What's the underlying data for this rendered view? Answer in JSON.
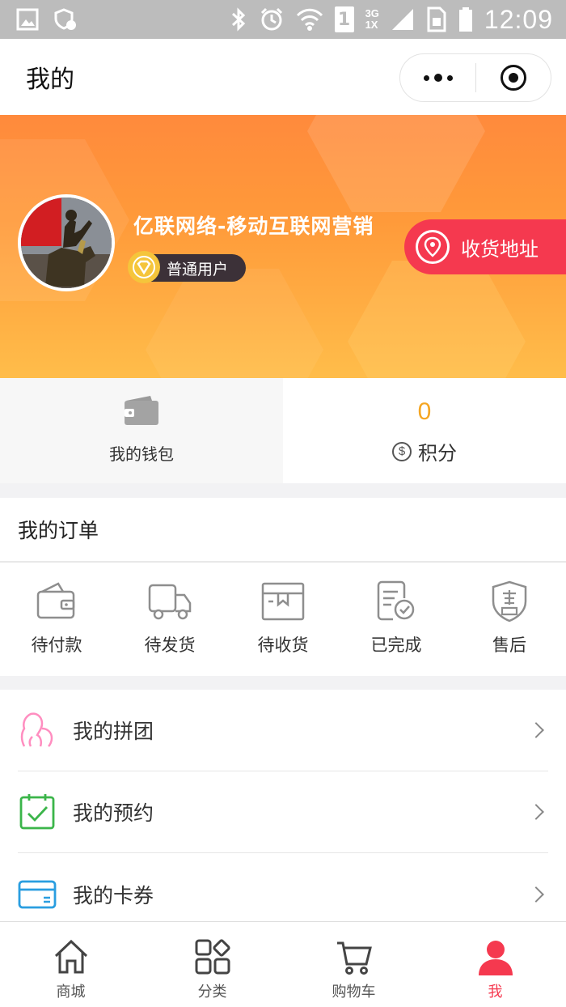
{
  "status_bar": {
    "time": "12:09",
    "sim_slot": "1",
    "network_top": "3G",
    "network_bottom": "1X"
  },
  "nav": {
    "title": "我的"
  },
  "profile": {
    "username": "亿联网络-移动互联网营销",
    "level": "普通用户",
    "address_button": "收货地址"
  },
  "stats": {
    "wallet_label": "我的钱包",
    "points_value": "0",
    "points_label": "积分"
  },
  "orders": {
    "title": "我的订单",
    "items": [
      {
        "label": "待付款",
        "icon": "wallet-pay-icon"
      },
      {
        "label": "待发货",
        "icon": "truck-icon"
      },
      {
        "label": "待收货",
        "icon": "package-icon"
      },
      {
        "label": "已完成",
        "icon": "checked-document-icon"
      },
      {
        "label": "售后",
        "icon": "after-sales-shield-icon"
      }
    ]
  },
  "menu": {
    "items": [
      {
        "label": "我的拼团",
        "icon": "group-buy-icon"
      },
      {
        "label": "我的预约",
        "icon": "calendar-check-icon"
      },
      {
        "label": "我的卡券",
        "icon": "card-coupon-icon"
      }
    ]
  },
  "tabbar": {
    "items": [
      {
        "label": "商城",
        "icon": "home-icon"
      },
      {
        "label": "分类",
        "icon": "category-icon"
      },
      {
        "label": "购物车",
        "icon": "cart-icon"
      },
      {
        "label": "我",
        "icon": "user-icon"
      }
    ],
    "active_color": "#f5394f"
  },
  "colors": {
    "banner_top": "#ff8a3c",
    "banner_bottom": "#ffbd4a",
    "accent_red": "#f5394f",
    "points_orange": "#f5a623"
  }
}
